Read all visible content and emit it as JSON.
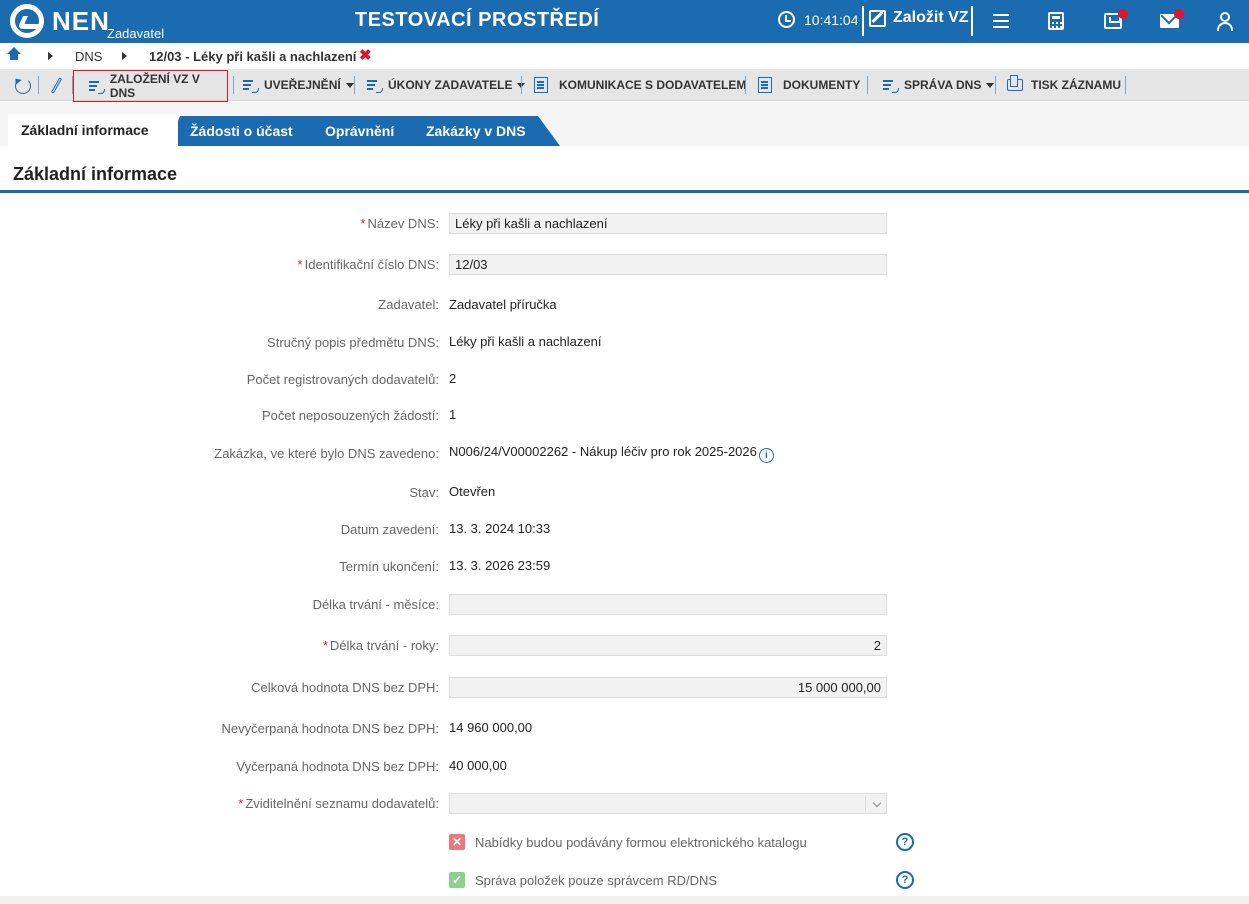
{
  "header": {
    "logo_text": "NEN",
    "logo_sub": "Zadavatel",
    "env_title": "TESTOVACÍ PROSTŘEDÍ",
    "time": "10:41:04",
    "create_label": "Založit VZ"
  },
  "breadcrumb": {
    "items": [
      "DNS",
      "12/03 - Léky při kašli a nachlazení"
    ],
    "close_symbol": "✖"
  },
  "toolbar": {
    "items": [
      "ZALOŽENÍ VZ V DNS",
      "UVEŘEJNĚNÍ",
      "ÚKONY ZADAVATELE",
      "KOMUNIKACE S DODAVATELEM",
      "DOKUMENTY",
      "SPRÁVA DNS",
      "TISK ZÁZNAMU"
    ]
  },
  "tabs": [
    {
      "label": "Základní informace",
      "active": true
    },
    {
      "label": "Žádosti o účast",
      "active": false
    },
    {
      "label": "Oprávnění",
      "active": false
    },
    {
      "label": "Zakázky v DNS",
      "active": false
    }
  ],
  "section": {
    "title": "Základní informace"
  },
  "form": {
    "nazev_label": "Název DNS:",
    "nazev_value": "Léky při kašli a nachlazení",
    "ident_label": "Identifikační číslo DNS:",
    "ident_value": "12/03",
    "zadavatel_label": "Zadavatel:",
    "zadavatel_value": "Zadavatel příručka",
    "popis_label": "Stručný popis předmětu DNS:",
    "popis_value": "Léky při kašli a nachlazení",
    "pocet_reg_label": "Počet registrovaných dodavatelů:",
    "pocet_reg_value": "2",
    "pocet_nepos_label": "Počet neposouzených žádostí:",
    "pocet_nepos_value": "1",
    "zakazka_label": "Zakázka, ve které bylo DNS zavedeno:",
    "zakazka_value": "N006/24/V00002262 - Nákup léčiv pro rok 2025-2026",
    "info_symbol": "i",
    "stav_label": "Stav:",
    "stav_value": "Otevřen",
    "datum_label": "Datum zavedení:",
    "datum_value": "13. 3. 2024 10:33",
    "termin_label": "Termín ukončení:",
    "termin_value": "13. 3. 2026 23:59",
    "delka_mesice_label": "Délka trvání - měsíce:",
    "delka_mesice_value": "",
    "delka_roky_label": "Délka trvání - roky:",
    "delka_roky_value": "2",
    "celkova_label": "Celková hodnota DNS bez DPH:",
    "celkova_value": "15 000 000,00",
    "nevycerpana_label": "Nevyčerpaná hodnota DNS bez DPH:",
    "nevycerpana_value": "14 960 000,00",
    "vycerpana_label": "Vyčerpaná hodnota DNS bez DPH:",
    "vycerpana_value": "40 000,00",
    "zviditelneni_label": "Zviditelnění seznamu dodavatelů:",
    "zviditelneni_value": "",
    "required_mark": "*",
    "cb1_label": "Nabídky budou podávány formou elektronického katalogu",
    "cb1_symbol": "✕",
    "cb2_label": "Správa položek pouze správcem RD/DNS",
    "cb2_symbol": "✓",
    "help_symbol": "?"
  },
  "colors": {
    "primary": "#1b6bb0",
    "alert": "#e0142b"
  }
}
